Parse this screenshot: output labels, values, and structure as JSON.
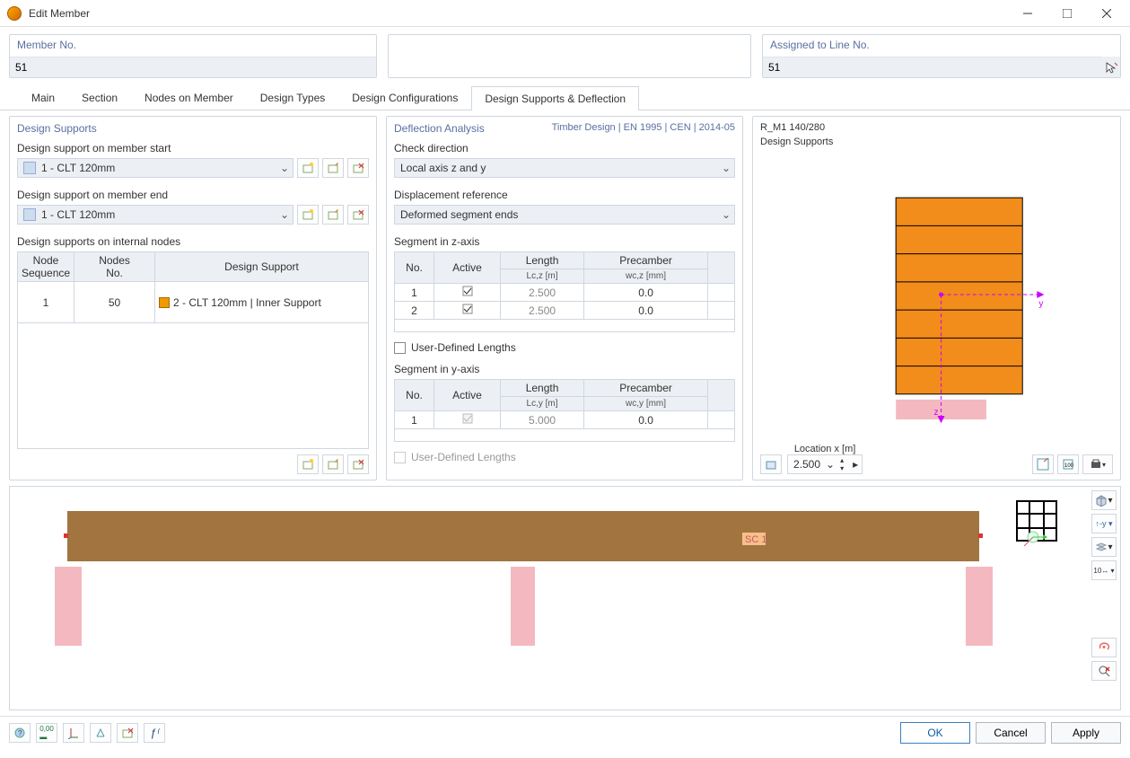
{
  "window": {
    "title": "Edit Member"
  },
  "header": {
    "member_no_label": "Member No.",
    "member_no": "51",
    "assigned_label": "Assigned to Line No.",
    "assigned_value": "51"
  },
  "tabs": [
    "Main",
    "Section",
    "Nodes on Member",
    "Design Types",
    "Design Configurations",
    "Design Supports & Deflection"
  ],
  "active_tab_index": 5,
  "left": {
    "title": "Design Supports",
    "support_start_label": "Design support on member start",
    "support_start_value": "1 - CLT   120mm",
    "support_end_label": "Design support on member end",
    "support_end_value": "1 - CLT   120mm",
    "internal_label": "Design supports on internal nodes",
    "table_headers": {
      "seq": "Node\nSequence",
      "nodes": "Nodes\nNo.",
      "sup": "Design Support"
    },
    "rows": [
      {
        "seq": "1",
        "node": "50",
        "support": "2 - CLT   120mm | Inner Support"
      }
    ]
  },
  "mid": {
    "title": "Deflection Analysis",
    "code": "Timber Design | EN 1995 | CEN | 2014-05",
    "check_dir_label": "Check direction",
    "check_dir_value": "Local axis z and y",
    "disp_ref_label": "Displacement reference",
    "disp_ref_value": "Deformed segment ends",
    "seg_z_label": "Segment in z-axis",
    "seg_y_label": "Segment in y-axis",
    "col_no": "No.",
    "col_active": "Active",
    "col_length": "Length",
    "col_precamber": "Precamber",
    "sub_lcz": "Lc,z [m]",
    "sub_wcz": "wc,z [mm]",
    "sub_lcy": "Lc,y [m]",
    "sub_wcy": "wc,y [mm]",
    "z_rows": [
      {
        "no": "1",
        "active": true,
        "length": "2.500",
        "precamber": "0.0"
      },
      {
        "no": "2",
        "active": true,
        "length": "2.500",
        "precamber": "0.0"
      }
    ],
    "y_rows": [
      {
        "no": "1",
        "active": true,
        "length": "5.000",
        "precamber": "0.0"
      }
    ],
    "udl_label": "User-Defined Lengths"
  },
  "right": {
    "section": "R_M1 140/280",
    "subtitle": "Design Supports",
    "location_label": "Location x [m]",
    "location_value": "2.500"
  },
  "preview": {
    "badge": "SC 1"
  },
  "footer": {
    "ok": "OK",
    "cancel": "Cancel",
    "apply": "Apply"
  }
}
